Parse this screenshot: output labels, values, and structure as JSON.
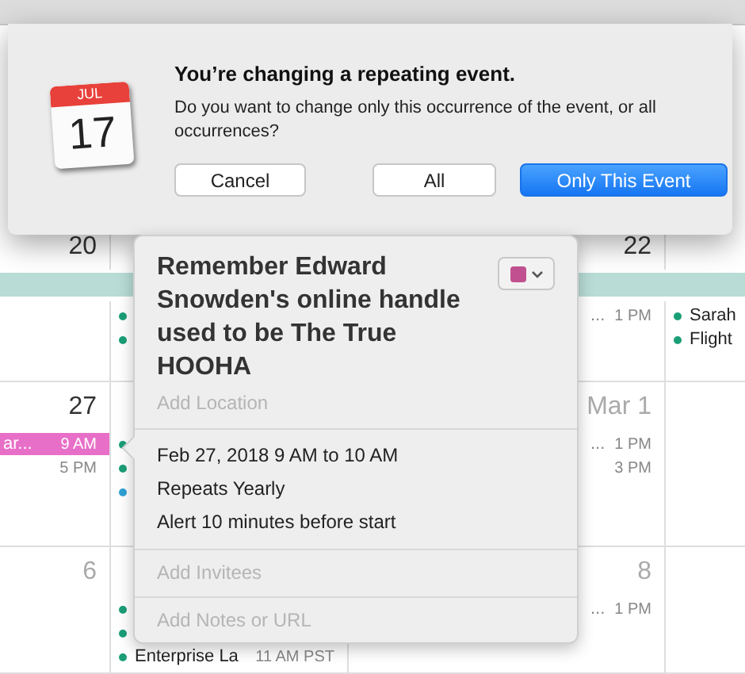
{
  "dialog": {
    "icon_month": "JUL",
    "icon_day": "17",
    "title": "You’re changing a repeating event.",
    "message": "Do you want to change only this occurrence of the event, or all occurrences?",
    "buttons": [
      {
        "label": "Cancel",
        "default": false
      },
      {
        "label": "All",
        "default": false
      },
      {
        "label": "Only This Event",
        "default": true
      }
    ]
  },
  "calendar": {
    "weeks": [
      {
        "all_day_bar": {
          "color": "#b9dcd6"
        },
        "cells": [
          {
            "date": "20",
            "in_month": true
          },
          {
            "events": [
              {
                "kind": "dot",
                "color": "#1a9e78"
              },
              {
                "kind": "dot",
                "color": "#1a9e78"
              }
            ]
          },
          {
            "date": "22",
            "in_month": true,
            "events": [
              {
                "kind": "trailing",
                "title": "...",
                "time": "1 PM"
              }
            ]
          },
          {
            "events": [
              {
                "kind": "dot",
                "color": "#1a9e78",
                "title": "Sarah"
              },
              {
                "kind": "dot",
                "color": "#1a9e78",
                "title": "Flight"
              }
            ]
          }
        ]
      },
      {
        "cells": [
          {
            "date": "27",
            "in_month": true,
            "events": [
              {
                "kind": "block",
                "color": "#e86fc8",
                "title": "ar...",
                "time": "9 AM"
              },
              {
                "kind": "trailing",
                "time": "5 PM"
              }
            ]
          },
          {
            "events": [
              {
                "kind": "dot",
                "color": "#1a9e78"
              },
              {
                "kind": "dot",
                "color": "#1a9e78"
              },
              {
                "kind": "dot",
                "color": "#2fa1d6"
              }
            ]
          },
          {
            "date": "Mar 1",
            "in_month": false,
            "events": [
              {
                "kind": "trailing",
                "title": "...",
                "time": "1 PM"
              },
              {
                "kind": "trailing",
                "time": "3 PM"
              }
            ]
          },
          {}
        ]
      },
      {
        "cells": [
          {
            "date": "6",
            "in_month": false
          },
          {
            "events": [
              {
                "kind": "dot",
                "color": "#1a9e78"
              },
              {
                "kind": "dot",
                "color": "#1a9e78"
              },
              {
                "kind": "dot",
                "color": "#1a9e78",
                "title": "Enterprise La",
                "time": "11 AM PST"
              }
            ]
          },
          {
            "date": "8",
            "in_month": false,
            "events": [
              {
                "kind": "trailing",
                "title": "...",
                "time": "1 PM"
              }
            ]
          },
          {}
        ]
      }
    ]
  },
  "popover": {
    "title": "Remember Edward Snowden's online handle used to be The True HOOHA",
    "color": "#c0508f",
    "location_placeholder": "Add Location",
    "details": [
      "Feb 27, 2018  9 AM to 10 AM",
      "Repeats Yearly",
      "Alert 10 minutes before start"
    ],
    "invitees_placeholder": "Add Invitees",
    "notes_placeholder": "Add Notes or URL"
  }
}
